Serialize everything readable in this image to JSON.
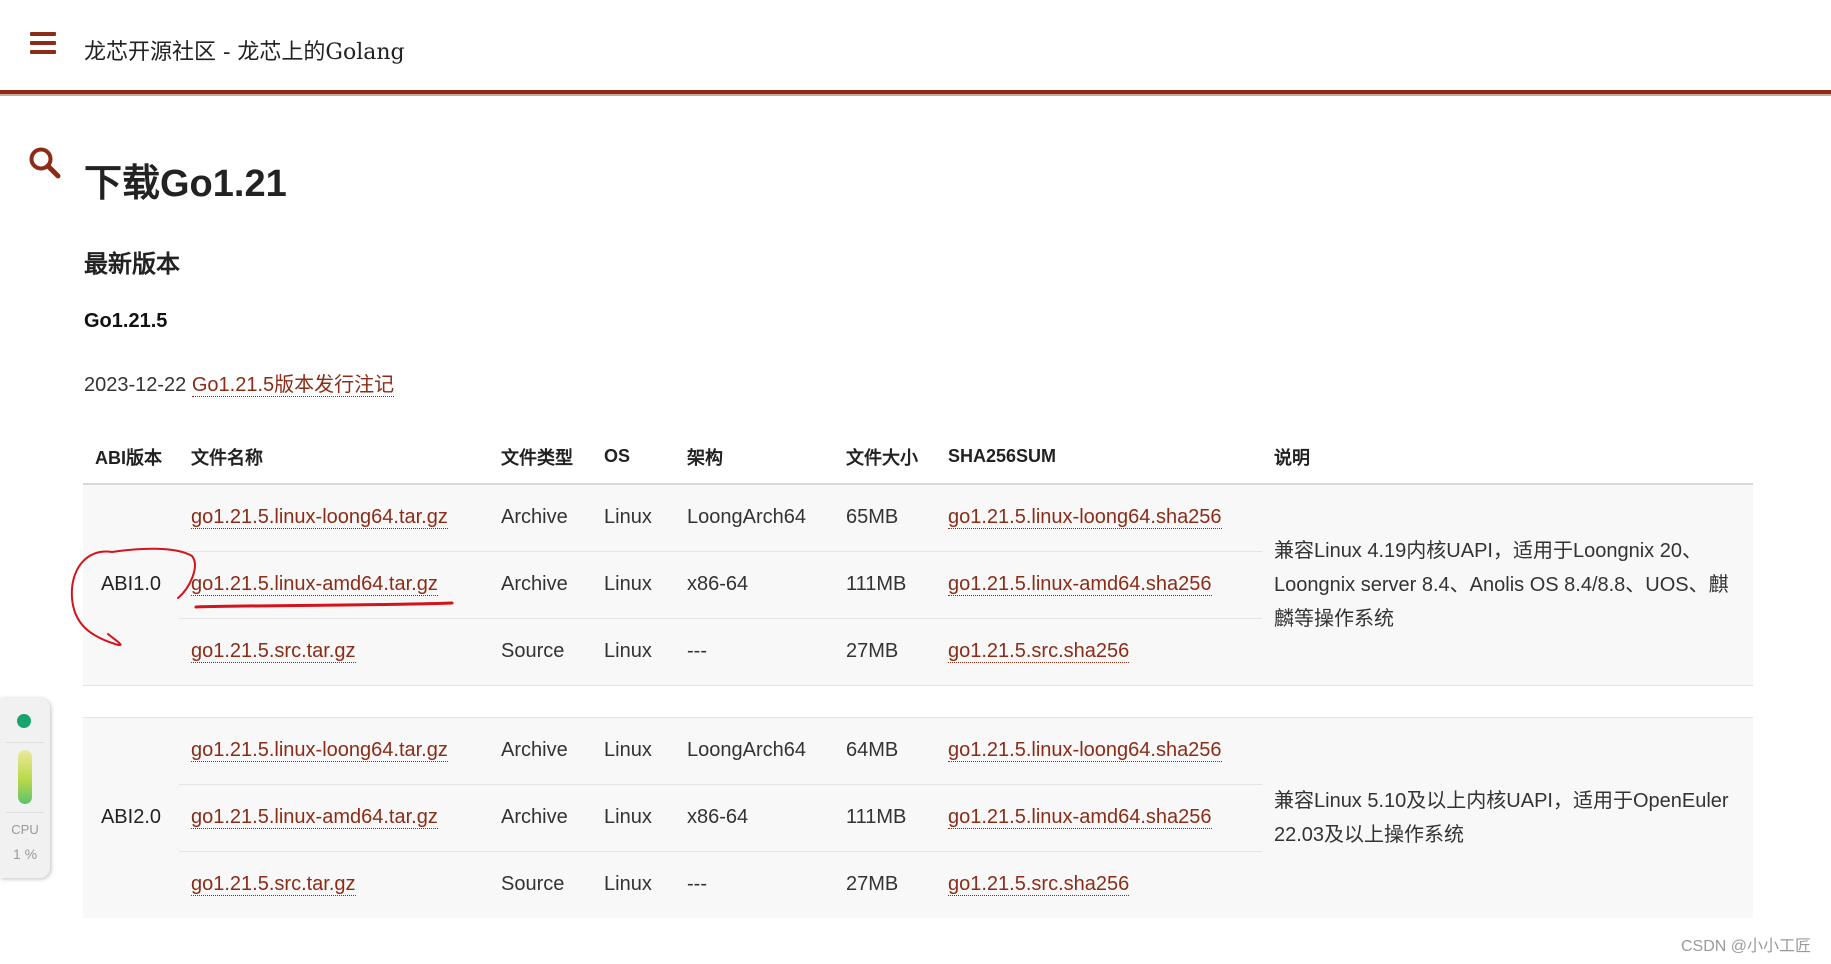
{
  "header": {
    "site_title": "龙芯开源社区 - 龙芯上的Golang"
  },
  "page": {
    "title": "下载Go1.21",
    "section_title": "最新版本",
    "version": "Go1.21.5",
    "release_date": "2023-12-22",
    "release_notes_link": "Go1.21.5版本发行注记"
  },
  "table": {
    "headers": [
      "ABI版本",
      "文件名称",
      "文件类型",
      "OS",
      "架构",
      "文件大小",
      "SHA256SUM",
      "说明"
    ],
    "groups": [
      {
        "abi": "ABI1.0",
        "description": "兼容Linux 4.19内核UAPI，适用于Loongnix 20、Loongnix server 8.4、Anolis OS 8.4/8.8、UOS、麒麟等操作系统",
        "rows": [
          {
            "file": "go1.21.5.linux-loong64.tar.gz",
            "type": "Archive",
            "os": "Linux",
            "arch": "LoongArch64",
            "size": "65MB",
            "sha": "go1.21.5.linux-loong64.sha256"
          },
          {
            "file": "go1.21.5.linux-amd64.tar.gz",
            "type": "Archive",
            "os": "Linux",
            "arch": "x86-64",
            "size": "111MB",
            "sha": "go1.21.5.linux-amd64.sha256"
          },
          {
            "file": "go1.21.5.src.tar.gz",
            "type": "Source",
            "os": "Linux",
            "arch": "---",
            "size": "27MB",
            "sha": "go1.21.5.src.sha256"
          }
        ]
      },
      {
        "abi": "ABI2.0",
        "description": "兼容Linux 5.10及以上内核UAPI，适用于OpenEuler 22.03及以上操作系统",
        "rows": [
          {
            "file": "go1.21.5.linux-loong64.tar.gz",
            "type": "Archive",
            "os": "Linux",
            "arch": "LoongArch64",
            "size": "64MB",
            "sha": "go1.21.5.linux-loong64.sha256"
          },
          {
            "file": "go1.21.5.linux-amd64.tar.gz",
            "type": "Archive",
            "os": "Linux",
            "arch": "x86-64",
            "size": "111MB",
            "sha": "go1.21.5.linux-amd64.sha256"
          },
          {
            "file": "go1.21.5.src.tar.gz",
            "type": "Source",
            "os": "Linux",
            "arch": "---",
            "size": "27MB",
            "sha": "go1.21.5.src.sha256"
          }
        ]
      }
    ]
  },
  "cpu_widget": {
    "label": "CPU",
    "value": "1 %"
  },
  "watermark": "CSDN @小小工匠",
  "colors": {
    "accent": "#8c2c17",
    "annotation": "#d4141c",
    "row_bg": "#f7f8f7"
  }
}
